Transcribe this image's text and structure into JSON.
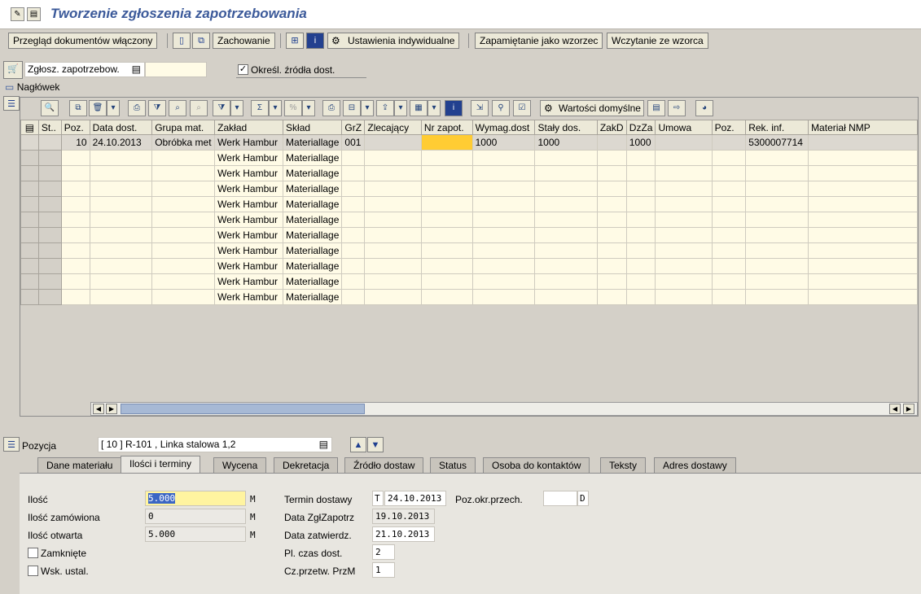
{
  "window": {
    "title": "Tworzenie zgłoszenia zapotrzebowania"
  },
  "toolbar": {
    "doc_overview": "Przegląd dokumentów włączony",
    "hold": "Zachowanie",
    "personal_settings": "Ustawienia indywidualne",
    "save_template": "Zapamiętanie jako wzorzec",
    "load_template": "Wczytanie ze wzorca"
  },
  "header": {
    "doc_type": "Zgłosz. zapotrzebow.",
    "source_determination_label": "Określ. źródła dost.",
    "source_determination_checked": true,
    "header_label": "Nagłówek"
  },
  "grid": {
    "default_values_label": "Wartości domyślne",
    "columns": [
      "St..",
      "Poz.",
      "Data dost.",
      "Grupa mat.",
      "Zakład",
      "Skład",
      "GrZ",
      "Zlecający",
      "Nr zapot.",
      "Wymag.dost",
      "Stały dos.",
      "ZakD",
      "DzZa",
      "Umowa",
      "Poz.",
      "Rek. inf.",
      "Materiał NMP"
    ],
    "rows": [
      [
        "",
        "10",
        "24.10.2013",
        "Obróbka met",
        "Werk Hambur",
        "Materiallage",
        "001",
        "",
        "",
        "1000",
        "1000",
        "",
        "1000",
        "",
        "",
        "5300007714",
        ""
      ],
      [
        "",
        "",
        "",
        "",
        "Werk Hambur",
        "Materiallage",
        "",
        "",
        "",
        "",
        "",
        "",
        "",
        "",
        "",
        "",
        ""
      ],
      [
        "",
        "",
        "",
        "",
        "Werk Hambur",
        "Materiallage",
        "",
        "",
        "",
        "",
        "",
        "",
        "",
        "",
        "",
        "",
        ""
      ],
      [
        "",
        "",
        "",
        "",
        "Werk Hambur",
        "Materiallage",
        "",
        "",
        "",
        "",
        "",
        "",
        "",
        "",
        "",
        "",
        ""
      ],
      [
        "",
        "",
        "",
        "",
        "Werk Hambur",
        "Materiallage",
        "",
        "",
        "",
        "",
        "",
        "",
        "",
        "",
        "",
        "",
        ""
      ],
      [
        "",
        "",
        "",
        "",
        "Werk Hambur",
        "Materiallage",
        "",
        "",
        "",
        "",
        "",
        "",
        "",
        "",
        "",
        "",
        ""
      ],
      [
        "",
        "",
        "",
        "",
        "Werk Hambur",
        "Materiallage",
        "",
        "",
        "",
        "",
        "",
        "",
        "",
        "",
        "",
        "",
        ""
      ],
      [
        "",
        "",
        "",
        "",
        "Werk Hambur",
        "Materiallage",
        "",
        "",
        "",
        "",
        "",
        "",
        "",
        "",
        "",
        "",
        ""
      ],
      [
        "",
        "",
        "",
        "",
        "Werk Hambur",
        "Materiallage",
        "",
        "",
        "",
        "",
        "",
        "",
        "",
        "",
        "",
        "",
        ""
      ],
      [
        "",
        "",
        "",
        "",
        "Werk Hambur",
        "Materiallage",
        "",
        "",
        "",
        "",
        "",
        "",
        "",
        "",
        "",
        "",
        ""
      ],
      [
        "",
        "",
        "",
        "",
        "Werk Hambur",
        "Materiallage",
        "",
        "",
        "",
        "",
        "",
        "",
        "",
        "",
        "",
        "",
        ""
      ]
    ]
  },
  "item": {
    "label": "Pozycja",
    "selected": "[ 10 ] R-101 , Linka stalowa 1,2"
  },
  "tabs": [
    "Dane materiału",
    "Ilości i terminy",
    "Wycena",
    "Dekretacja",
    "Źródło dostaw",
    "Status",
    "Osoba do kontaktów",
    "Teksty",
    "Adres dostawy"
  ],
  "qty": {
    "quantity_label": "Ilość",
    "quantity": "5.000",
    "quantity_unit": "M",
    "ordered_label": "Ilość zamówiona",
    "ordered": "0",
    "ordered_unit": "M",
    "open_label": "Ilość otwarta",
    "open": "5.000",
    "open_unit": "M",
    "closed_label": "Zamknięte",
    "fixed_label": "Wsk. ustal."
  },
  "dates": {
    "delivery_label": "Termin dostawy",
    "delivery_type": "T",
    "delivery": "24.10.2013",
    "req_date_label": "Data ZgłZapotrz",
    "req_date": "19.10.2013",
    "release_label": "Data zatwierdz.",
    "release": "21.10.2013",
    "plan_time_label": "Pl. czas dost.",
    "plan_time": "2",
    "gr_time_label": "Cz.przetw. PrzM",
    "gr_time": "1",
    "pos_label": "Poz.okr.przech.",
    "pos_value": "",
    "pos_code": "D"
  }
}
